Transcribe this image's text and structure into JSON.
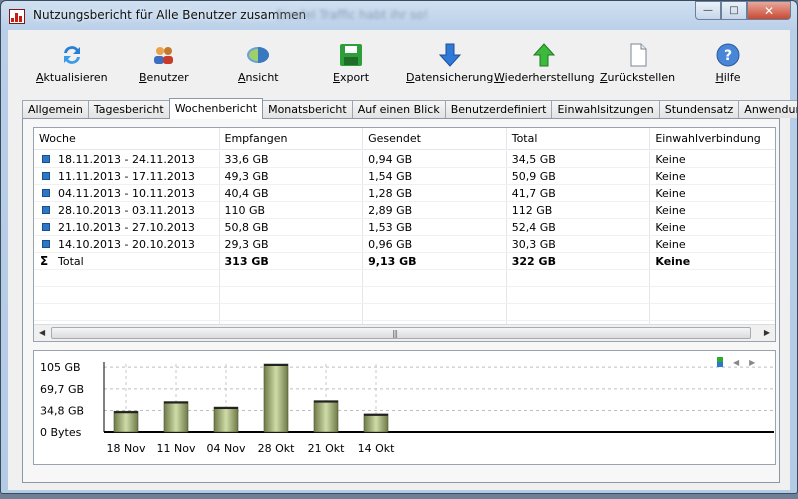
{
  "window": {
    "title": "Nutzungsbericht für Alle Benutzer zusammen",
    "background_title": "Eiesfel Traffic habt ihr so!",
    "controls": {
      "minimize": "—",
      "maximize": "□",
      "close": "✕"
    }
  },
  "toolbar": {
    "items": [
      {
        "label_pre": "",
        "label_u": "A",
        "label_post": "ktualisieren",
        "icon": "refresh-icon"
      },
      {
        "label_pre": "",
        "label_u": "B",
        "label_post": "enutzer",
        "icon": "users-icon"
      },
      {
        "label_pre": "",
        "label_u": "A",
        "label_post": "nsicht",
        "icon": "view-icon"
      },
      {
        "label_pre": "",
        "label_u": "E",
        "label_post": "xport",
        "icon": "save-icon"
      },
      {
        "label_pre": "",
        "label_u": "D",
        "label_post": "atensicherung",
        "icon": "backup-icon"
      },
      {
        "label_pre": "",
        "label_u": "W",
        "label_post": "iederherstellung",
        "icon": "restore-icon"
      },
      {
        "label_pre": "",
        "label_u": "Z",
        "label_post": "urückstellen",
        "icon": "reset-icon"
      },
      {
        "label_pre": "",
        "label_u": "H",
        "label_post": "ilfe",
        "icon": "help-icon"
      }
    ]
  },
  "tabs": [
    "Allgemein",
    "Tagesbericht",
    "Wochenbericht",
    "Monatsbericht",
    "Auf einen Blick",
    "Benutzerdefiniert",
    "Einwahlsitzungen",
    "Stundensatz",
    "Anwendungen"
  ],
  "active_tab": "Wochenbericht",
  "table": {
    "columns": [
      "Woche",
      "Empfangen",
      "Gesendet",
      "Total",
      "Einwahlverbindung"
    ],
    "rows": [
      [
        "18.11.2013 - 24.11.2013",
        "33,6 GB",
        "0,94 GB",
        "34,5 GB",
        "Keine"
      ],
      [
        "11.11.2013 - 17.11.2013",
        "49,3 GB",
        "1,54 GB",
        "50,9 GB",
        "Keine"
      ],
      [
        "04.11.2013 - 10.11.2013",
        "40,4 GB",
        "1,28 GB",
        "41,7 GB",
        "Keine"
      ],
      [
        "28.10.2013 - 03.11.2013",
        "110 GB",
        "2,89 GB",
        "112 GB",
        "Keine"
      ],
      [
        "21.10.2013 - 27.10.2013",
        "50,8 GB",
        "1,53 GB",
        "52,4 GB",
        "Keine"
      ],
      [
        "14.10.2013 - 20.10.2013",
        "29,3 GB",
        "0,96 GB",
        "30,3 GB",
        "Keine"
      ]
    ],
    "total": [
      "Total",
      "313 GB",
      "9,13 GB",
      "322 GB",
      "Keine"
    ],
    "total_symbol": "Σ"
  },
  "chart_data": {
    "type": "bar",
    "categories": [
      "18 Nov",
      "11 Nov",
      "04 Nov",
      "28 Okt",
      "21 Okt",
      "14 Okt"
    ],
    "values": [
      33.6,
      49.3,
      40.4,
      110,
      50.8,
      29.3
    ],
    "unit": "GB",
    "ytick_labels": [
      "0 Bytes",
      "34,8 GB",
      "69,7 GB",
      "105 GB"
    ],
    "ytick_values": [
      0,
      34.8,
      69.7,
      105
    ],
    "ylim": [
      0,
      110
    ],
    "grid": true,
    "colors": {
      "bar": "#a8b878",
      "bar_top": "#222222"
    }
  }
}
